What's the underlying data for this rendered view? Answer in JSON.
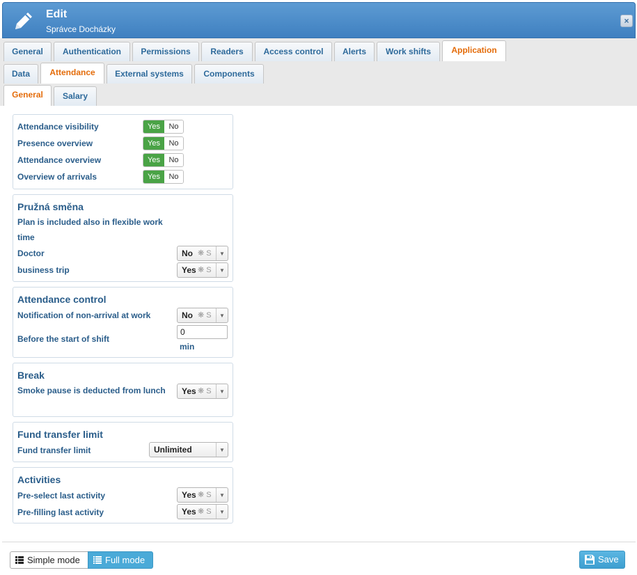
{
  "header": {
    "title": "Edit",
    "subtitle": "Správce Docházky",
    "close": "×"
  },
  "tabs_row1": [
    "General",
    "Authentication",
    "Permissions",
    "Readers",
    "Access control",
    "Alerts",
    "Work shifts",
    "Application"
  ],
  "tabs_row2": [
    "Data",
    "Attendance",
    "External systems",
    "Components"
  ],
  "tabs_row3": [
    "General",
    "Salary"
  ],
  "active_tabs": {
    "row1": "Application",
    "row2": "Attendance",
    "row3": "General"
  },
  "visibility": {
    "rows": [
      "Attendance visibility",
      "Presence overview",
      "Attendance overview",
      "Overview of arrivals"
    ],
    "yes": "Yes",
    "no": "No"
  },
  "flex": {
    "title": "Pružná směna",
    "plan_label_1": "Plan is included also in flexible work",
    "plan_label_2": "time",
    "doctor_label": "Doctor",
    "doctor_value": "No",
    "trip_label": "business trip",
    "trip_value": "Yes"
  },
  "control": {
    "title": "Attendance control",
    "notif_label": "Notification of non-arrival at work",
    "notif_value": "No",
    "before_label": "Before the start of shift",
    "before_value": "0",
    "unit": "min"
  },
  "break": {
    "title": "Break",
    "smoke_label": "Smoke pause is deducted from lunch",
    "smoke_value": "Yes"
  },
  "fund": {
    "title": "Fund transfer limit",
    "label": "Fund transfer limit",
    "value": "Unlimited"
  },
  "activities": {
    "title": "Activities",
    "preselect_label": "Pre-select last activity",
    "preselect_value": "Yes",
    "prefill_label": "Pre-filling last activity",
    "prefill_value": "Yes"
  },
  "select_spin": "❋ S",
  "select_arrow": "▼",
  "footer": {
    "simple_mode": "Simple mode",
    "full_mode": "Full mode",
    "save": "Save"
  },
  "colors": {
    "header": "#4a8bc9",
    "active_tab": "#e46c0a",
    "label": "#2a5d8a",
    "toggle_yes": "#4aa346",
    "accent_button": "#4aaad8"
  }
}
